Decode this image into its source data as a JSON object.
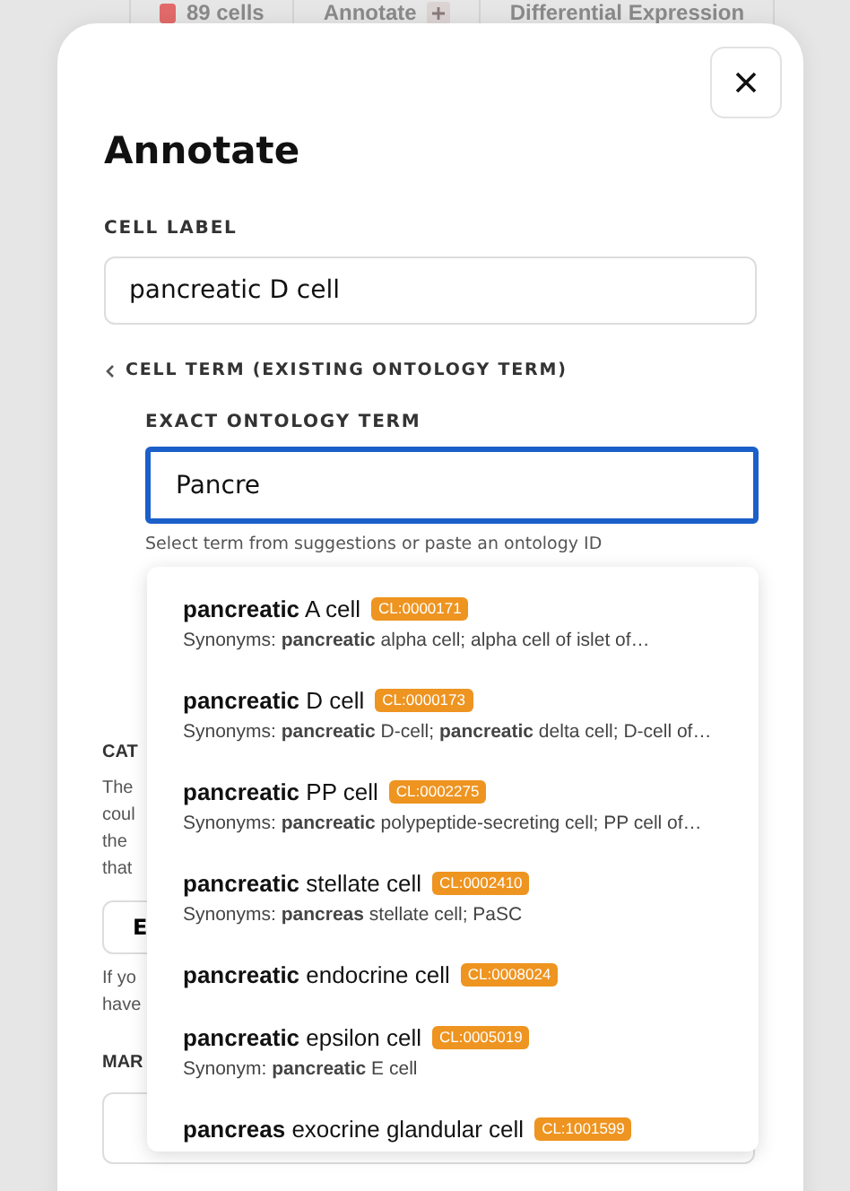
{
  "top_tabs": [
    {
      "label": "89 cells",
      "kind": "count"
    },
    {
      "label": "Annotate",
      "kind": "add"
    },
    {
      "label": "Differential Expression",
      "kind": "plain"
    }
  ],
  "dialog": {
    "title": "Annotate",
    "cell_label": {
      "label": "CELL LABEL",
      "value": "pancreatic D cell"
    },
    "cell_term": {
      "label": "CELL TERM (EXISTING ONTOLOGY TERM)",
      "expanded": true,
      "exact_term": {
        "label": "EXACT ONTOLOGY TERM",
        "value": "Pancre",
        "focused": true,
        "hint": "Select term from suggestions or paste an ontology ID"
      }
    },
    "category": {
      "label": "CAT",
      "description_lines": [
        "The",
        "coul",
        "the",
        "that"
      ],
      "button": "E",
      "note_lines": [
        "If yo",
        "have"
      ]
    },
    "marker": {
      "label": "MAR"
    },
    "suggestions": [
      {
        "term": "**pancreatic** A cell",
        "id": "CL:0000171",
        "synonyms": "Synonyms: **pancreatic** alpha cell; alpha cell of islet of…"
      },
      {
        "term": "**pancreatic** D cell",
        "id": "CL:0000173",
        "synonyms": "Synonyms: **pancreatic** D-cell; **pancreatic** delta cell; D-cell of…"
      },
      {
        "term": "**pancreatic** PP cell",
        "id": "CL:0002275",
        "synonyms": "Synonyms: **pancreatic** polypeptide-secreting cell; PP cell of…"
      },
      {
        "term": "**pancreatic** stellate cell",
        "id": "CL:0002410",
        "synonyms": "Synonyms: **pancreas** stellate cell; PaSC"
      },
      {
        "term": "**pancreatic** endocrine cell",
        "id": "CL:0008024"
      },
      {
        "term": "**pancreatic** epsilon cell",
        "id": "CL:0005019",
        "synonyms": "Synonym: **pancreatic** E cell"
      },
      {
        "term": "**pancreas** exocrine glandular cell",
        "id": "CL:1001599"
      }
    ]
  }
}
